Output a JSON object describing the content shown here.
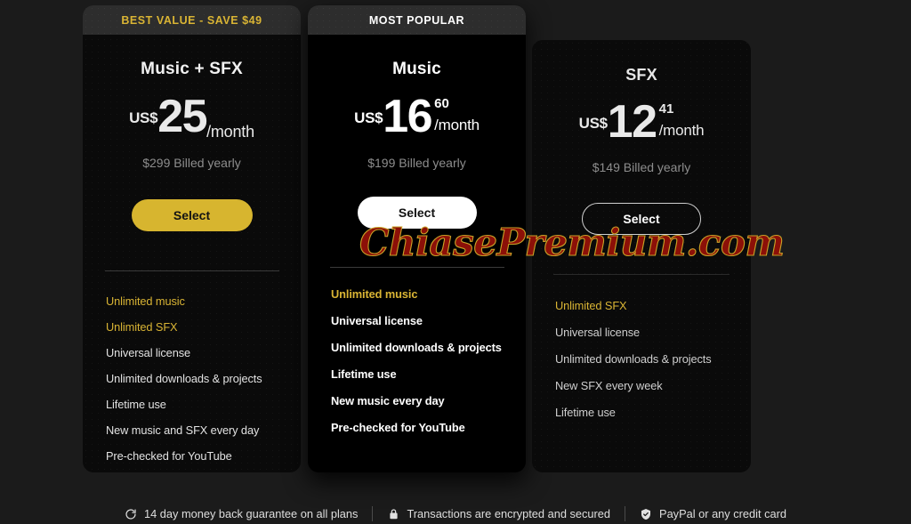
{
  "plans": [
    {
      "id": "music-sfx",
      "badge": "BEST VALUE - SAVE $49",
      "badge_style": "gold",
      "title": "Music + SFX",
      "currency": "US$",
      "amount": "25",
      "cents": "",
      "period": "/month",
      "billed": "$299 Billed yearly",
      "cta": "Select",
      "features": [
        {
          "label": "Unlimited music",
          "highlight": true
        },
        {
          "label": "Unlimited SFX",
          "highlight": true
        },
        {
          "label": "Universal license",
          "highlight": false
        },
        {
          "label": "Unlimited downloads & projects",
          "highlight": false
        },
        {
          "label": "Lifetime use",
          "highlight": false
        },
        {
          "label": "New music and SFX every day",
          "highlight": false
        },
        {
          "label": "Pre-checked for YouTube",
          "highlight": false
        }
      ]
    },
    {
      "id": "music",
      "badge": "MOST POPULAR",
      "badge_style": "white",
      "title": "Music",
      "currency": "US$",
      "amount": "16",
      "cents": "60",
      "period": "/month",
      "billed": "$199 Billed yearly",
      "cta": "Select",
      "features": [
        {
          "label": "Unlimited music",
          "highlight": true
        },
        {
          "label": "Universal license",
          "highlight": false
        },
        {
          "label": "Unlimited downloads & projects",
          "highlight": false
        },
        {
          "label": "Lifetime use",
          "highlight": false
        },
        {
          "label": "New music every day",
          "highlight": false
        },
        {
          "label": "Pre-checked for YouTube",
          "highlight": false
        }
      ]
    },
    {
      "id": "sfx",
      "badge": "",
      "badge_style": "none",
      "title": "SFX",
      "currency": "US$",
      "amount": "12",
      "cents": "41",
      "period": "/month",
      "billed": "$149 Billed yearly",
      "cta": "Select",
      "features": [
        {
          "label": "Unlimited SFX",
          "highlight": true
        },
        {
          "label": "Universal license",
          "highlight": false
        },
        {
          "label": "Unlimited downloads & projects",
          "highlight": false
        },
        {
          "label": "New SFX every week",
          "highlight": false
        },
        {
          "label": "Lifetime use",
          "highlight": false
        }
      ]
    }
  ],
  "footer": {
    "items": [
      {
        "icon": "refresh-icon",
        "label": "14 day money back guarantee on all plans"
      },
      {
        "icon": "lock-icon",
        "label": "Transactions are encrypted and secured"
      },
      {
        "icon": "shield-check-icon",
        "label": "PayPal or any credit card"
      }
    ]
  },
  "watermark": {
    "text": "ChiasePremium.com"
  },
  "colors": {
    "gold": "#d9b434",
    "button_gold": "#d7b52f",
    "page_bg": "#1b1b1b",
    "card_bg": "#0a0a0a",
    "featured_card_bg": "#000000",
    "watermark_red": "#8c1008"
  }
}
